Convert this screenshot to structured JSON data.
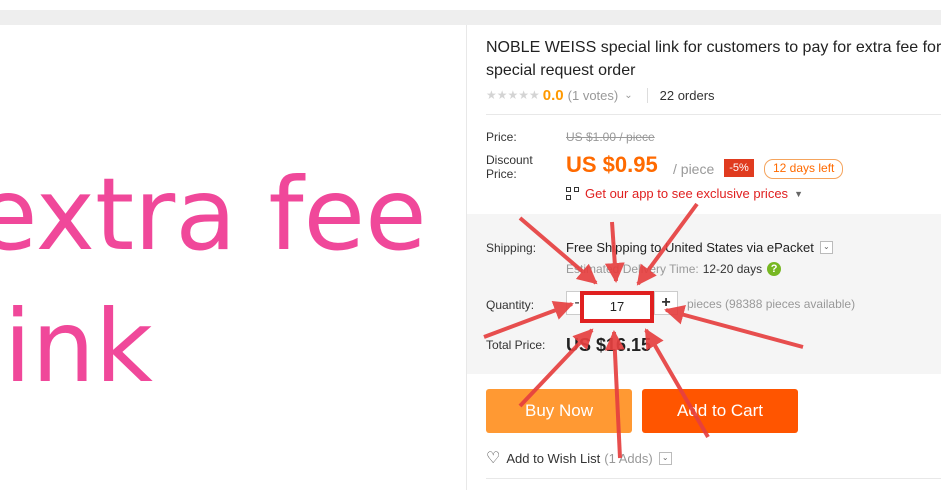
{
  "image": {
    "line1": "extra fee",
    "line2": "link"
  },
  "product": {
    "title": "NOBLE WEISS special link for customers to pay for extra fee for special request order",
    "stars_icon": "star-rating-icon",
    "rating": "0.0",
    "votes": "(1 votes)",
    "orders": "22 orders"
  },
  "price": {
    "price_label": "Price:",
    "original": "US $1.00 / piece",
    "discount_label_1": "Discount",
    "discount_label_2": "Price:",
    "discounted": "US $0.95",
    "per_piece": "/ piece",
    "discount_badge": "-5%",
    "days_left": "12 days left",
    "app_promo": "Get our app to see exclusive prices"
  },
  "shipping": {
    "label": "Shipping:",
    "method": "Free Shipping to United States via ePacket",
    "estimated_label": "Estimated Delivery Time:",
    "estimated_value": "12-20 days",
    "help_icon": "?"
  },
  "quantity": {
    "label": "Quantity:",
    "minus": "-",
    "value": "17",
    "plus": "+",
    "availability": "pieces (98388 pieces available)"
  },
  "total": {
    "label": "Total Price:",
    "value": "US $16.15"
  },
  "actions": {
    "buy_now": "Buy Now",
    "add_to_cart": "Add to Cart",
    "wish_list": "Add to Wish List",
    "wish_adds": "(1 Adds)"
  },
  "colors": {
    "accent_orange": "#ff6a00",
    "buy_button": "#ff9933",
    "cart_button": "#ff5500",
    "annotation_red": "#e02020",
    "image_text_pink": "#f0489a"
  }
}
